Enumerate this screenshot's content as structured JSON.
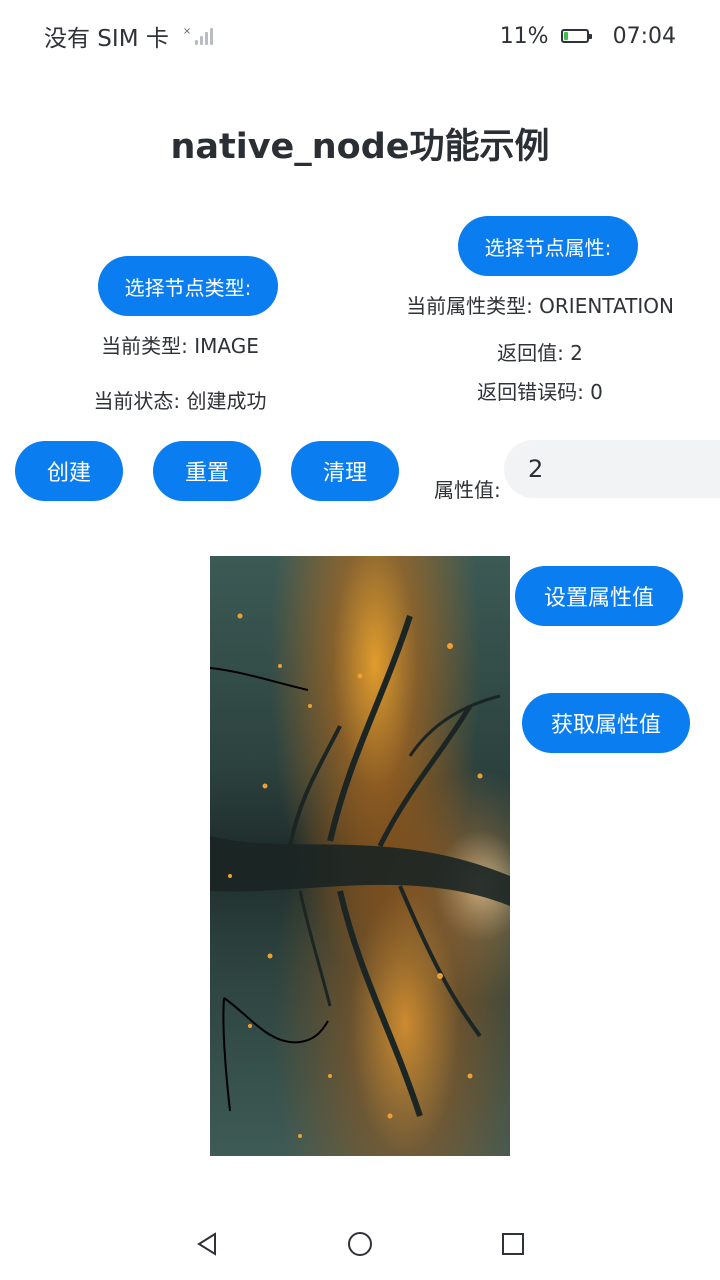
{
  "status_bar": {
    "carrier": "没有 SIM 卡",
    "battery_percent": "11%",
    "time": "07:04"
  },
  "title": "native_node功能示例",
  "node_type": {
    "button_label": "选择节点类型:",
    "current_type": "当前类型: IMAGE",
    "current_state": "当前状态: 创建成功"
  },
  "node_attribute": {
    "button_label": "选择节点属性:",
    "current_attr_type": "当前属性类型: ORIENTATION",
    "return_value": "返回值: 2",
    "return_error": "返回错误码: 0"
  },
  "actions": {
    "create": "创建",
    "reset": "重置",
    "clear": "清理"
  },
  "attr_value": {
    "label": "属性值:",
    "value": "2"
  },
  "set_attr_button": "设置属性值",
  "get_attr_button": "获取属性值",
  "colors": {
    "accent": "#0a7df0",
    "input_bg": "#f1f3f5"
  },
  "nav_bar": {
    "back_icon": "triangle-back-icon",
    "home_icon": "circle-home-icon",
    "recents_icon": "square-recents-icon"
  }
}
